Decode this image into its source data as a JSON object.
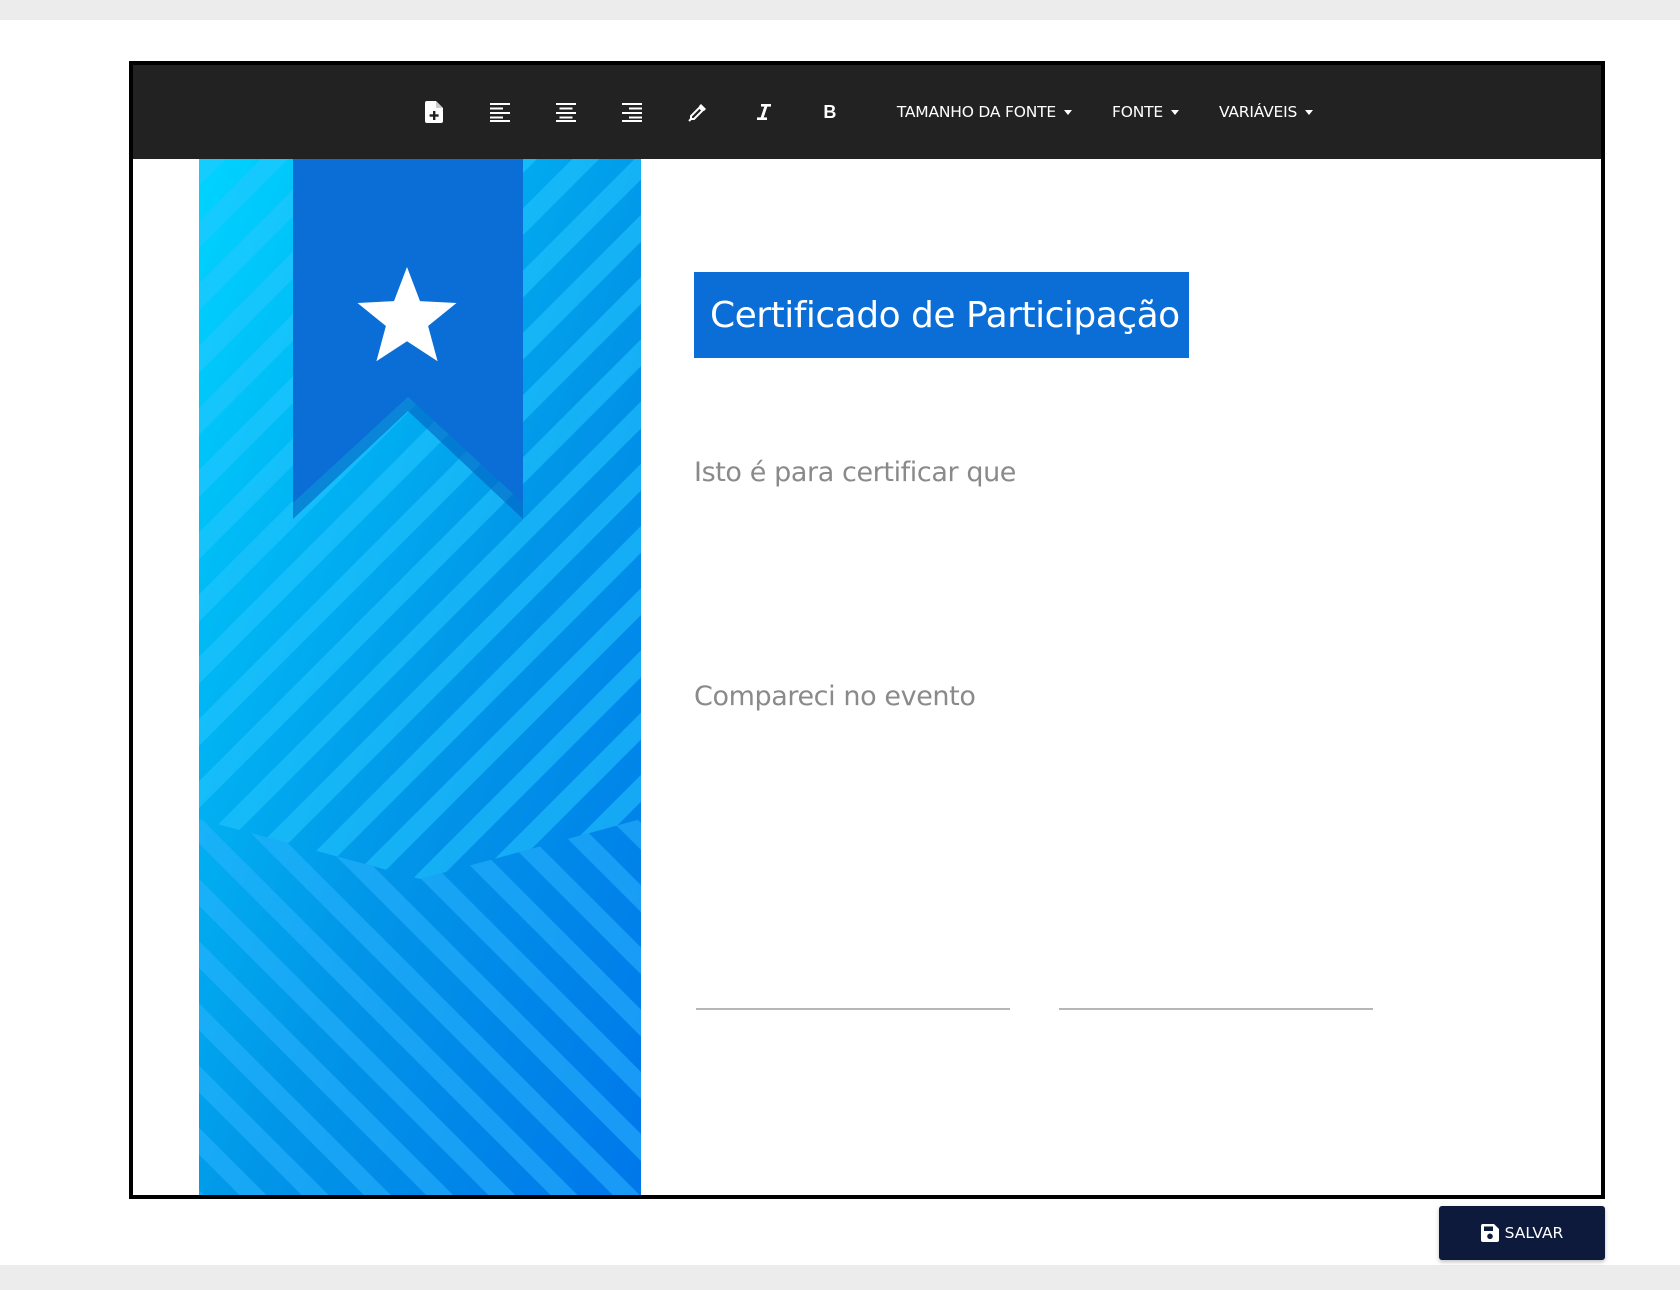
{
  "toolbar": {
    "icons": {
      "new_page": "file-plus-icon",
      "align_left": "align-left-icon",
      "align_center": "align-center-icon",
      "align_right": "align-right-icon",
      "color_picker": "eyedropper-icon",
      "italic": "italic-icon",
      "bold": "bold-icon"
    },
    "bold_label": "B",
    "font_size_label": "TAMANHO DA FONTE",
    "font_label": "FONTE",
    "variables_label": "VARIÁVEIS"
  },
  "certificate": {
    "title": "Certificado de Participação",
    "line1": "Isto é para certificar que",
    "line2": "Compareci no evento",
    "ribbon_icon": "star-icon"
  },
  "save": {
    "label": "SALVAR",
    "icon": "floppy-disk-icon"
  },
  "colors": {
    "toolbar_bg": "#222222",
    "title_bg": "#0a6ed6",
    "ribbon": "#0a6ed6",
    "band_light": "#00cfff",
    "band_dark": "#007fe6",
    "save_bg": "#0e1a3c"
  }
}
